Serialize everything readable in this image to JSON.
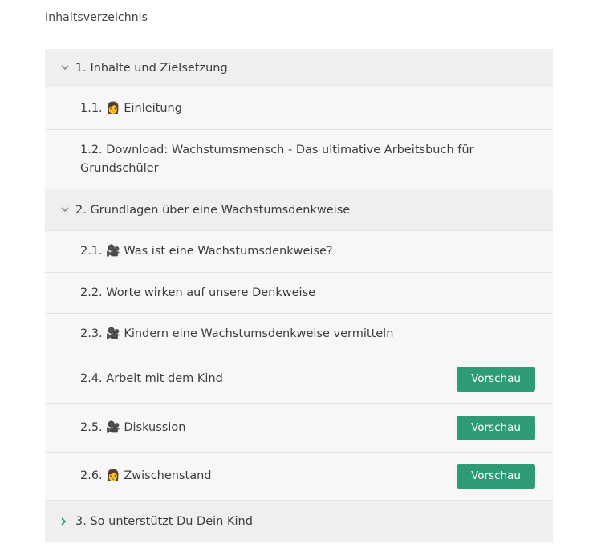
{
  "toc_title": "Inhaltsverzeichnis",
  "colors": {
    "accent": "#2e9b77",
    "section_bg": "#efefef",
    "lesson_bg": "#f7f7f7"
  },
  "sections": [
    {
      "label": "1. Inhalte und Zielsetzung",
      "expanded": true,
      "lessons": [
        {
          "prefix": "1.1.",
          "emoji": "👩",
          "text": "Einleitung",
          "preview": ""
        },
        {
          "prefix": "1.2.",
          "emoji": "",
          "text": "Download: Wachstumsmensch - Das ultimative Arbeitsbuch für Grundschüler",
          "preview": ""
        }
      ]
    },
    {
      "label": "2. Grundlagen über eine Wachstumsdenkweise",
      "expanded": true,
      "lessons": [
        {
          "prefix": "2.1.",
          "emoji": "🎥",
          "text": "Was ist eine Wachstumsdenkweise?",
          "preview": ""
        },
        {
          "prefix": "2.2.",
          "emoji": "",
          "text": "Worte wirken auf unsere Denkweise",
          "preview": ""
        },
        {
          "prefix": "2.3.",
          "emoji": "🎥",
          "text": "Kindern eine Wachstumsdenkweise vermitteln",
          "preview": ""
        },
        {
          "prefix": "2.4.",
          "emoji": "",
          "text": "Arbeit mit dem Kind",
          "preview": "Vorschau"
        },
        {
          "prefix": "2.5.",
          "emoji": "🎥",
          "text": "Diskussion",
          "preview": "Vorschau"
        },
        {
          "prefix": "2.6.",
          "emoji": "👩",
          "text": "Zwischenstand",
          "preview": "Vorschau"
        }
      ]
    },
    {
      "label": "3. So unterstützt Du Dein Kind",
      "expanded": false,
      "lessons": []
    }
  ]
}
